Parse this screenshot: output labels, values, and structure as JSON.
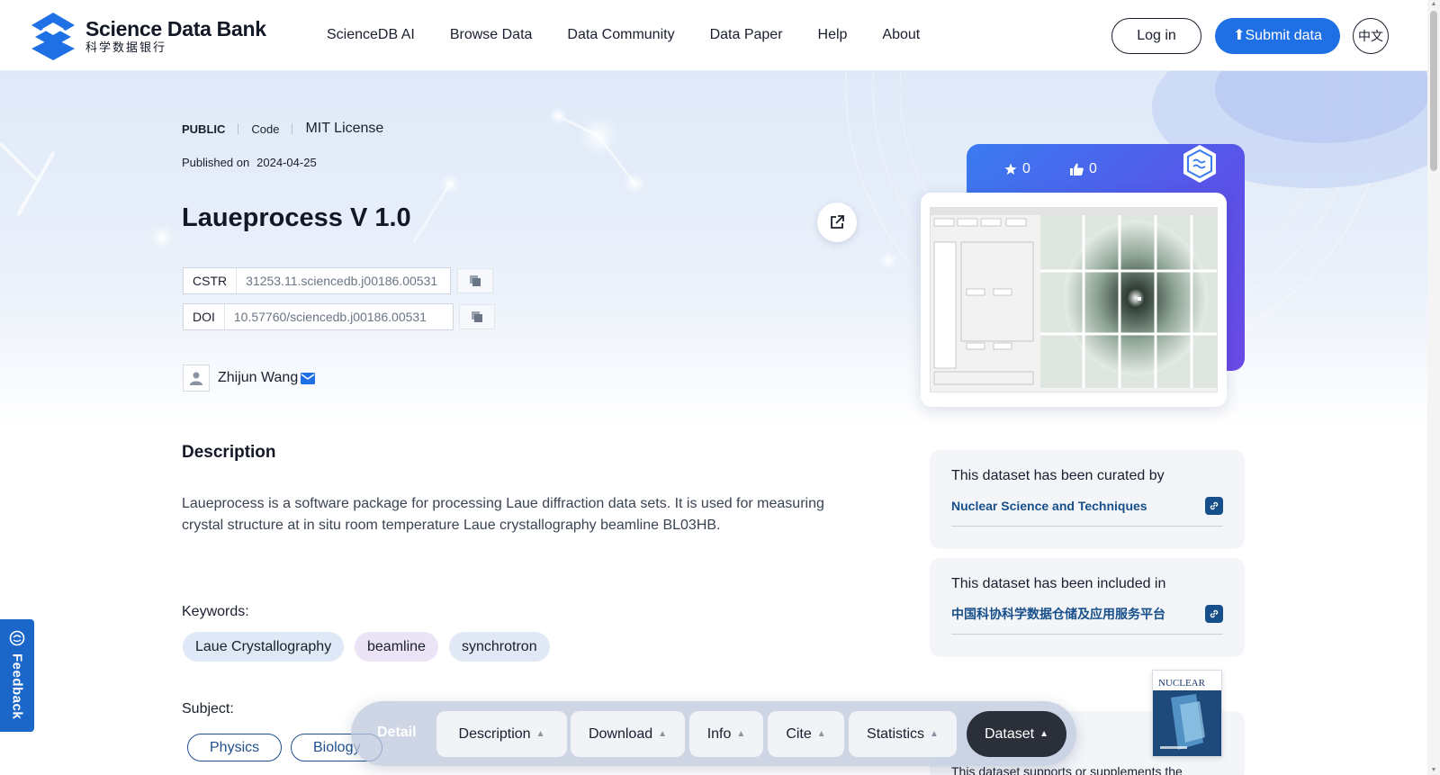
{
  "header": {
    "logo_en": "Science Data Bank",
    "logo_cn": "科学数据银行",
    "nav": [
      "ScienceDB AI",
      "Browse Data",
      "Data Community",
      "Data Paper",
      "Help",
      "About"
    ],
    "login": "Log in",
    "submit": "Submit data",
    "lang": "中文"
  },
  "dataset": {
    "visibility": "PUBLIC",
    "type": "Code",
    "license": "MIT License",
    "published_label": "Published on",
    "published_date": "2024-04-25",
    "title": "Laueprocess V 1.0",
    "cstr_label": "CSTR",
    "cstr": "31253.11.sciencedb.j00186.00531",
    "doi_label": "DOI",
    "doi": "10.57760/sciencedb.j00186.00531",
    "author": "Zhijun Wang",
    "description_title": "Description",
    "description": "Laueprocess is a software package for processing Laue diffraction data sets. It is used for measuring crystal structure at in situ room temperature Laue crystallography beamline BL03HB.",
    "keywords_label": "Keywords:",
    "keywords": [
      "Laue Crystallography",
      "beamline",
      "synchrotron"
    ],
    "subject_label": "Subject:",
    "subjects": [
      "Physics",
      "Biology"
    ]
  },
  "sidebar": {
    "stars": "0",
    "likes": "0",
    "curated_lead": "This dataset has been curated by",
    "curated_by": "Nuclear Science and Techniques",
    "included_lead": "This dataset has been included in",
    "included_in": "中国科协科学数据仓储及应用服务平台",
    "supports_lead": "This dataset supports or supplements the",
    "journal_cover": "NUCLEAR"
  },
  "feedback": "Feedback",
  "floatnav": {
    "detail": "Detail",
    "tabs": [
      "Description",
      "Download",
      "Info",
      "Cite",
      "Statistics",
      "Dataset"
    ],
    "active": "Dataset"
  },
  "colors": {
    "accent": "#1f6fe5",
    "link": "#174f8a",
    "feedback": "#1a67c9"
  }
}
